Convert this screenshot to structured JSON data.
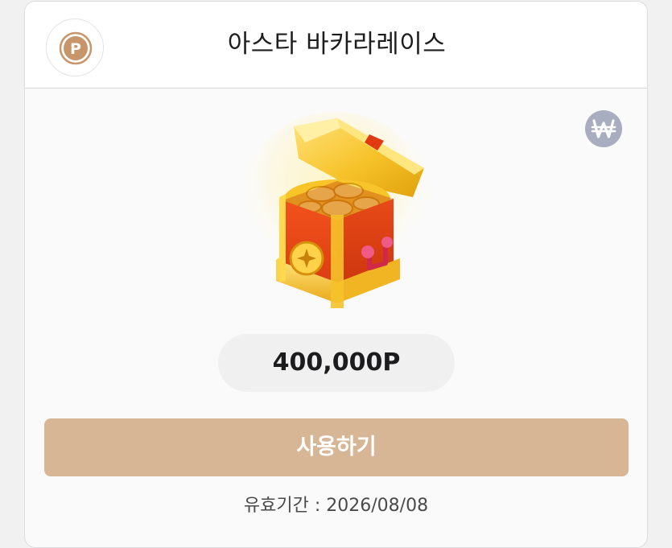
{
  "header": {
    "point_icon": "point-coin-icon",
    "title": "아스타 바카라레이스"
  },
  "currency_badge": {
    "icon": "won-icon",
    "symbol": "₩"
  },
  "reward": {
    "image": "treasure-chest-icon",
    "amount": "400,000P"
  },
  "action": {
    "use_label": "사용하기"
  },
  "expiry": {
    "label": "유효기간 :",
    "date": "2026/08/08"
  },
  "colors": {
    "accent_button": "#d7b696",
    "point_badge": "#c8946a",
    "won_badge": "#a8aec0"
  }
}
